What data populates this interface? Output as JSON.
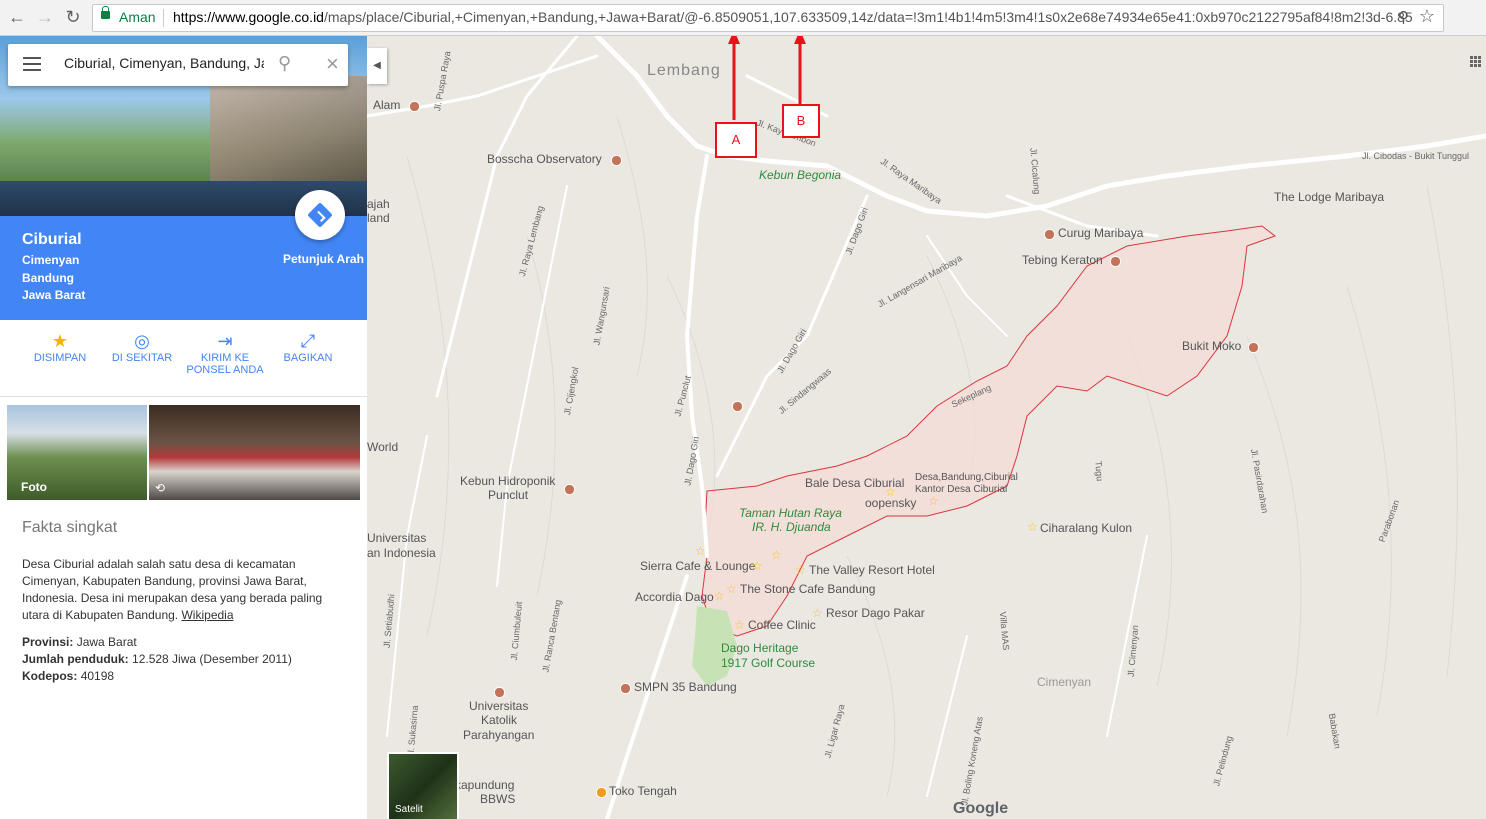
{
  "browser": {
    "secure_label": "Aman",
    "url_host": "https://www.google.co.id",
    "url_path": "/maps/place/Ciburial,+Cimenyan,+Bandung,+Jawa+Barat/@-6.8509051,107.633509,14z/data=!3m1!4b1!4m5!3m4!1s0x2e68e74934e65e41:0xb970c2122795af84!8m2!3d-6.85..."
  },
  "search": {
    "value": "Ciburial, Cimenyan, Bandung, Jaw"
  },
  "place": {
    "title": "Ciburial",
    "sub1": "Cimenyan",
    "sub2": "Bandung",
    "sub3": "Jawa Barat",
    "directions_label": "Petunjuk Arah"
  },
  "actions": [
    {
      "label": "DISIMPAN",
      "icon": "star-icon"
    },
    {
      "label": "DI SEKITAR",
      "icon": "nearby-icon"
    },
    {
      "label": "KIRIM KE PONSEL ANDA",
      "icon": "send-to-phone-icon"
    },
    {
      "label": "BAGIKAN",
      "icon": "share-icon"
    }
  ],
  "photos": {
    "label": "Foto"
  },
  "facts": {
    "title": "Fakta singkat",
    "description": "Desa Ciburial adalah salah satu desa di kecamatan Cimenyan, Kabupaten Bandung, provinsi Jawa Barat, Indonesia. Desa ini merupakan desa yang berada paling utara di Kabupaten Bandung.",
    "source": "Wikipedia",
    "province_key": "Provinsi:",
    "province_val": "Jawa Barat",
    "population_key": "Jumlah penduduk:",
    "population_val": "12.528 Jiwa (Desember 2011)",
    "postcode_key": "Kodepos:",
    "postcode_val": "40198"
  },
  "map": {
    "labels": {
      "lembang": "Lembang",
      "alam": "Alam",
      "bosscha": "Bosscha Observatory",
      "begonia": "Kebun Begonia",
      "curug": "Curug Maribaya",
      "lodge": "The Lodge Maribaya",
      "tebing": "Tebing Keraton",
      "moko": "Bukit Moko",
      "hidroponik1": "Kebun Hidroponik",
      "hidroponik2": "Punclut",
      "bale": "Bale Desa Ciburial",
      "kantor1": "Desa,Bandung,Ciburial",
      "kantor2": "Kantor Desa Ciburial",
      "oopensky": "oopensky",
      "taman1": "Taman Hutan Raya",
      "taman2": "IR. H. Djuanda",
      "ciharalang": "Ciharalang Kulon",
      "sierra": "Sierra Cafe & Lounge",
      "valley": "The Valley Resort Hotel",
      "stone": "The Stone Cafe Bandung",
      "accordia": "Accordia Dago",
      "resor": "Resor Dago Pakar",
      "coffee": "Coffee Clinic",
      "heritage1": "Dago Heritage",
      "heritage2": "1917 Golf Course",
      "smpn": "SMPN 35 Bandung",
      "univ1": "Universitas",
      "univ2": "Katolik",
      "univ3": "Parahyangan",
      "univ_left1": "Universitas",
      "univ_left2": "an Indonesia",
      "world": "World",
      "sajand1": "ajah",
      "sajand2": "land",
      "cimenyan": "Cimenyan",
      "toko": "Toko Tengah",
      "bbws1": "kapundung",
      "bbws2": "BBWS",
      "satellite": "Satelit",
      "google": "Google"
    },
    "roads": {
      "cibodas": "Jl. Cibodas - Bukit Tunggul",
      "raya_maribaya": "Jl. Raya Maribaya",
      "kayu_ambon": "Jl. Kayu Ambon",
      "dago_giri1": "Jl. Dago Giri",
      "dago_giri2": "Jl. Dago Giri",
      "dago_giri3": "Jl. Dago Giri",
      "langensari": "Jl. Langensari Maribaya",
      "sindangwaas": "Jl. Sindangwaas",
      "wangunsari": "Jl. Wangunsari",
      "cijengkol": "Jl. Cijengkol",
      "punclut": "Jl. Punclut",
      "raya_lembang": "Jl. Raya Lembang",
      "puspa": "Jl. Puspa Raya",
      "cicalung": "Jl. Cicalung",
      "sekeplang": "Sekeplang",
      "pasir": "Jl. Pasirdarahan",
      "tugu": "Tugu",
      "ciumbuleuit": "Jl. Ciumbuleuit",
      "ranca": "Jl. Ranca Bentang",
      "setiabudhi": "Jl. Setiabudhi",
      "ligar": "Jl. Ligar Raya",
      "cimenyan_rd": "Jl. Cimenyan",
      "villa": "Villa MAS",
      "boling": "Jl. Boling Koneng Atas",
      "pelindung": "Jl. Pelindung",
      "babakan": "Babakan",
      "siliwangi": "Jl. Sukasirna",
      "parabonan": "Parabonan"
    }
  },
  "annotations": {
    "a": "A",
    "b": "B"
  }
}
